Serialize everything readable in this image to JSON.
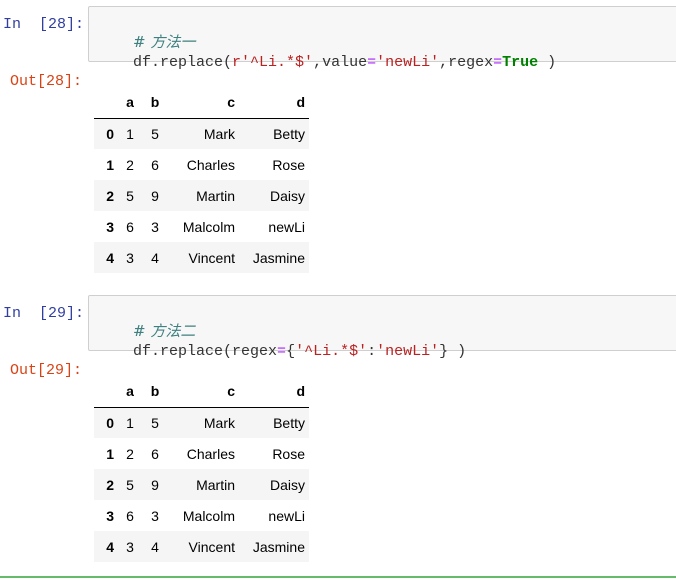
{
  "cells": [
    {
      "in_prompt": "In  [28]:",
      "out_prompt": "Out[28]:",
      "code": {
        "comment": "# 方法一",
        "line2_parts": [
          "df.replace(",
          "r'^Li.*$'",
          ",value",
          "=",
          "'newLi'",
          ",regex",
          "=",
          "True",
          " )"
        ]
      },
      "table": {
        "columns": [
          "a",
          "b",
          "c",
          "d"
        ],
        "rows": [
          {
            "index": "0",
            "a": "1",
            "b": "5",
            "c": "Mark",
            "d": "Betty"
          },
          {
            "index": "1",
            "a": "2",
            "b": "6",
            "c": "Charles",
            "d": "Rose"
          },
          {
            "index": "2",
            "a": "5",
            "b": "9",
            "c": "Martin",
            "d": "Daisy"
          },
          {
            "index": "3",
            "a": "6",
            "b": "3",
            "c": "Malcolm",
            "d": "newLi"
          },
          {
            "index": "4",
            "a": "3",
            "b": "4",
            "c": "Vincent",
            "d": "Jasmine"
          }
        ]
      }
    },
    {
      "in_prompt": "In  [29]:",
      "out_prompt": "Out[29]:",
      "code": {
        "comment": "# 方法二",
        "line2_parts": [
          "df.replace(regex",
          "=",
          "{",
          "'^Li.*$'",
          ":",
          "'newLi'",
          "} )"
        ]
      },
      "table": {
        "columns": [
          "a",
          "b",
          "c",
          "d"
        ],
        "rows": [
          {
            "index": "0",
            "a": "1",
            "b": "5",
            "c": "Mark",
            "d": "Betty"
          },
          {
            "index": "1",
            "a": "2",
            "b": "6",
            "c": "Charles",
            "d": "Rose"
          },
          {
            "index": "2",
            "a": "5",
            "b": "9",
            "c": "Martin",
            "d": "Daisy"
          },
          {
            "index": "3",
            "a": "6",
            "b": "3",
            "c": "Malcolm",
            "d": "newLi"
          },
          {
            "index": "4",
            "a": "3",
            "b": "4",
            "c": "Vincent",
            "d": "Jasmine"
          }
        ]
      }
    }
  ],
  "colors": {
    "in_prompt": "#303f9f",
    "out_prompt": "#d84315",
    "comment": "#408080",
    "string": "#ba2121",
    "operator": "#aa22ff",
    "keyword": "#008000",
    "active_cell_bar": "#66bb6a"
  }
}
